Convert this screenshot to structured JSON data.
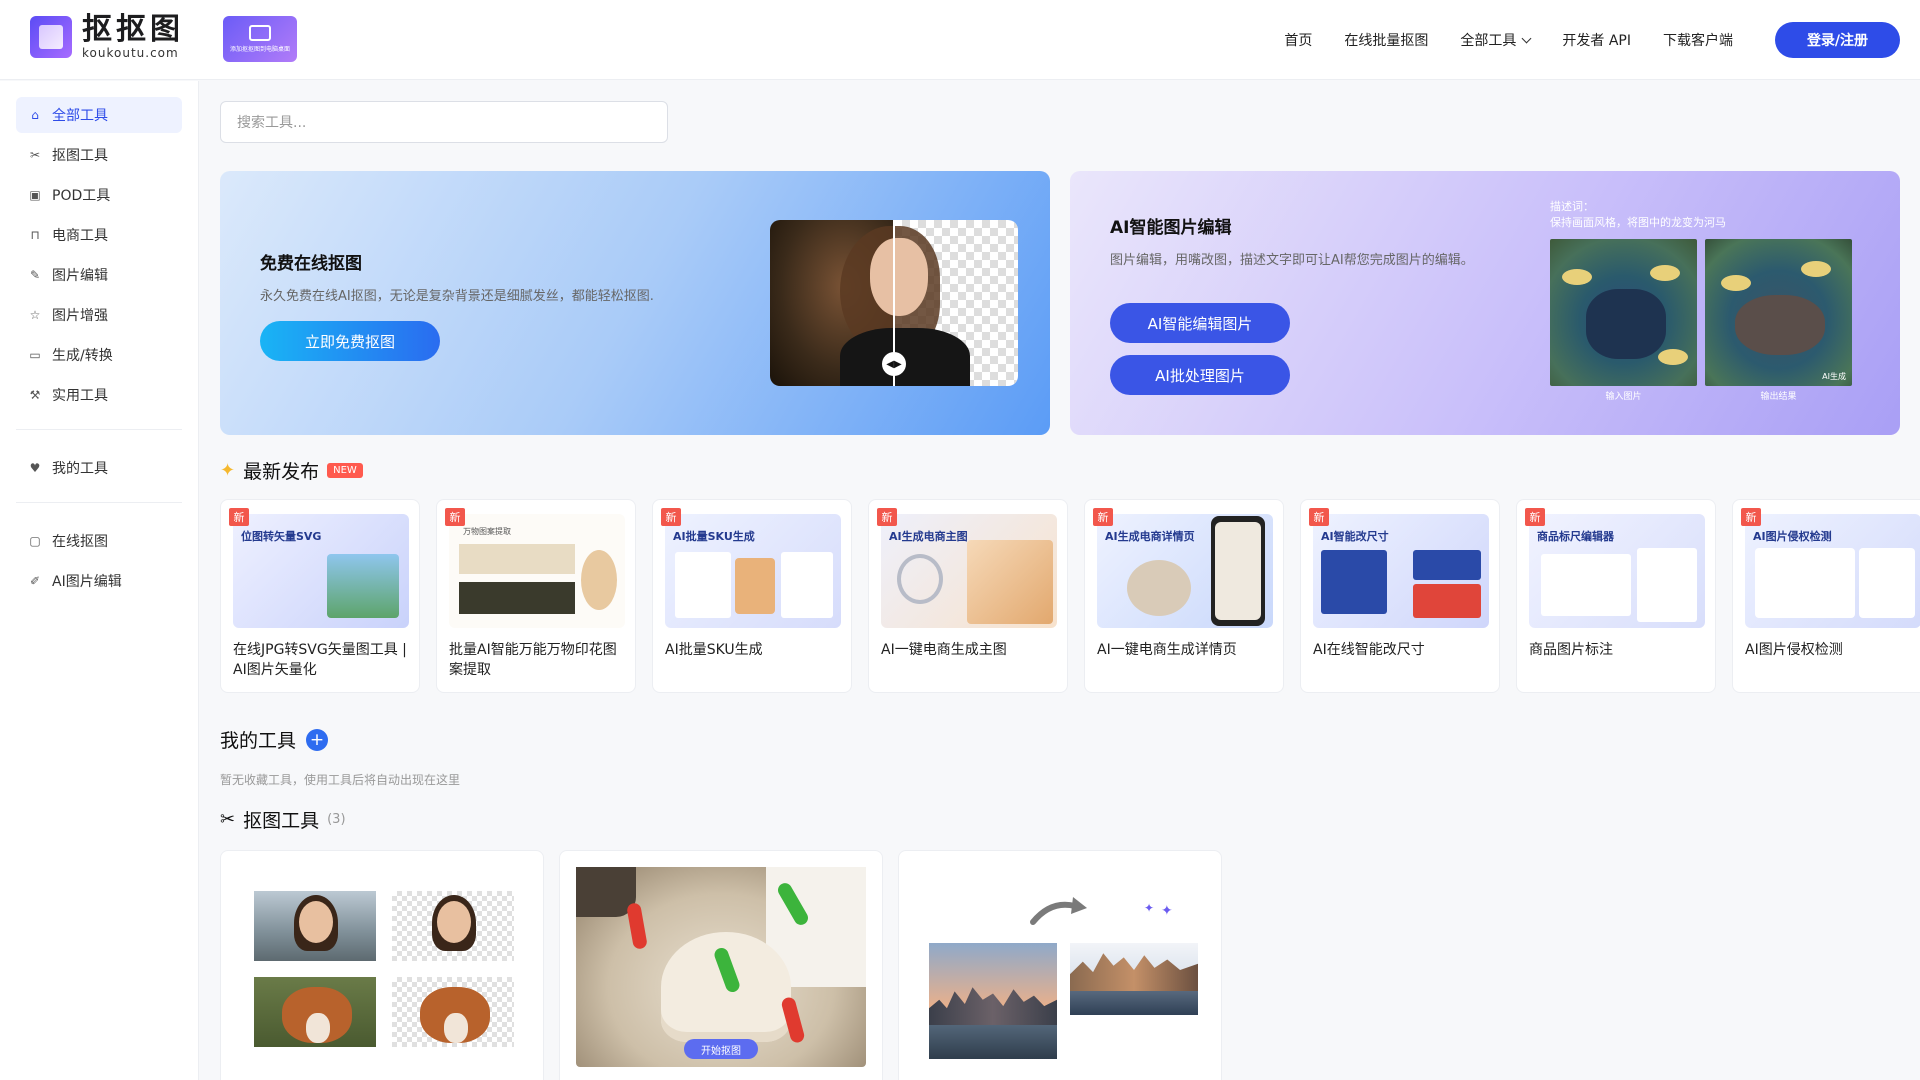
{
  "header": {
    "logo_cn": "抠抠图",
    "logo_en": "koukoutu.com",
    "desk_badge_caption": "添加抠抠图到电脑桌面",
    "nav": [
      "首页",
      "在线批量抠图",
      "全部工具",
      "开发者 API",
      "下载客户端"
    ],
    "login": "登录/注册"
  },
  "sidebar": {
    "items": [
      {
        "label": "全部工具",
        "icon": "home-icon",
        "active": true
      },
      {
        "label": "抠图工具",
        "icon": "scissors-icon"
      },
      {
        "label": "POD工具",
        "icon": "box-icon"
      },
      {
        "label": "电商工具",
        "icon": "bag-icon"
      },
      {
        "label": "图片编辑",
        "icon": "pen-icon"
      },
      {
        "label": "图片增强",
        "icon": "star-icon"
      },
      {
        "label": "生成/转换",
        "icon": "monitor-icon"
      },
      {
        "label": "实用工具",
        "icon": "wrench-icon"
      }
    ],
    "my_tools": "我的工具",
    "extra": [
      {
        "label": "在线抠图",
        "icon": "image-icon"
      },
      {
        "label": "AI图片编辑",
        "icon": "edit-icon"
      }
    ]
  },
  "search": {
    "placeholder": "搜索工具..."
  },
  "banner1": {
    "title": "免费在线抠图",
    "desc": "永久免费在线AI抠图，无论是复杂背景还是细腻发丝，都能轻松抠图.",
    "button": "立即免费抠图"
  },
  "banner2": {
    "title": "AI智能图片编辑",
    "desc": "图片编辑，用嘴改图，描述文字即可让AI帮您完成图片的编辑。",
    "button1": "AI智能编辑图片",
    "button2": "AI批处理图片",
    "hint_label": "描述词：",
    "hint_text": "保持画面风格，将图中的龙变为河马",
    "cap_in": "输入图片",
    "cap_out": "输出结果",
    "watermark": "AI生成"
  },
  "latest": {
    "title": "最新发布",
    "tag": "NEW",
    "badge": "新",
    "cards": [
      {
        "img_title": "位图转矢量SVG",
        "title": "在线JPG转SVG矢量图工具 | AI图片矢量化"
      },
      {
        "img_title": "万物图案提取",
        "title": "批量AI智能万能万物印花图案提取"
      },
      {
        "img_title": "AI批量SKU生成",
        "title": "AI批量SKU生成"
      },
      {
        "img_title": "AI生成电商主图",
        "title": "AI一键电商生成主图"
      },
      {
        "img_title": "AI生成电商详情页",
        "title": "AI一键电商生成详情页"
      },
      {
        "img_title": "AI智能改尺寸",
        "title": "AI在线智能改尺寸"
      },
      {
        "img_title": "商品标尺编辑器",
        "title": "商品图片标注"
      },
      {
        "img_title": "AI图片侵权检测",
        "title": "AI图片侵权检测"
      }
    ]
  },
  "my_tools": {
    "title": "我的工具",
    "empty": "暂无收藏工具，使用工具后将自动出现在这里"
  },
  "cutout": {
    "title": "抠图工具",
    "count": "(3)",
    "start": "开始抠图"
  }
}
